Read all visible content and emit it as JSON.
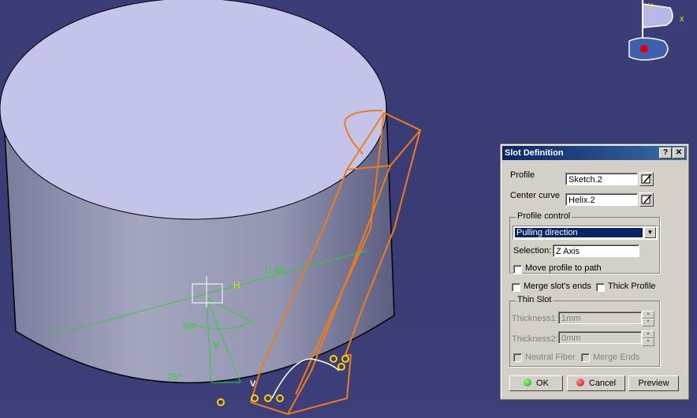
{
  "viewport": {
    "dimension_label": "D 80",
    "axis_labels": {
      "h": "H",
      "v": "V",
      "v_small": "V"
    },
    "angle_labels": [
      "60°",
      "25°"
    ],
    "compass_labels": {
      "y": "y",
      "x": "x"
    }
  },
  "dialog": {
    "title": "Slot Definition",
    "help_label": "?",
    "close_label": "✕",
    "profile_label": "Profile",
    "profile_value": "Sketch.2",
    "center_curve_label": "Center curve",
    "center_curve_value": "Helix.2",
    "profile_control": {
      "legend": "Profile control",
      "selected_option": "Pulling direction",
      "selection_label": "Selection:",
      "selection_value": "Z Axis",
      "move_profile_label": "Move profile to path"
    },
    "merge_ends_label": "Merge slot's ends",
    "thick_profile_label": "Thick Profile",
    "thin_slot": {
      "legend": "Thin Slot",
      "thickness1_label": "Thickness1:",
      "thickness1_value": "1mm",
      "thickness2_label": "Thickness2:",
      "thickness2_value": "0mm",
      "neutral_fiber_label": "Neutral Fiber",
      "merge_ends_label": "Merge Ends"
    },
    "buttons": {
      "ok": "OK",
      "cancel": "Cancel",
      "preview": "Preview"
    },
    "colors": {
      "ok": "#1aa01a",
      "cancel": "#d01010"
    }
  }
}
